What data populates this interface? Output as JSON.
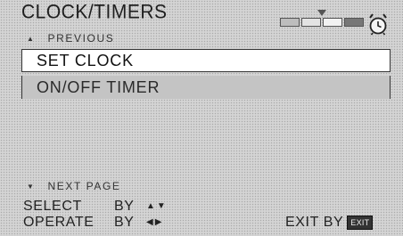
{
  "header": {
    "title": "CLOCK/TIMERS",
    "progress_level": 0.55
  },
  "nav": {
    "previous_label": "PREVIOUS",
    "next_label": "NEXT PAGE"
  },
  "menu": {
    "items": [
      {
        "label": "SET CLOCK",
        "selected": true
      },
      {
        "label": "ON/OFF TIMER",
        "selected": false
      }
    ]
  },
  "footer": {
    "select_label": "SELECT",
    "select_by": "BY",
    "operate_label": "OPERATE",
    "operate_by": "BY",
    "exit_label": "EXIT BY",
    "exit_key": "EXIT"
  },
  "icons": {
    "up": "triangle-up-icon",
    "down": "triangle-down-icon",
    "clock": "alarm-clock-icon"
  }
}
